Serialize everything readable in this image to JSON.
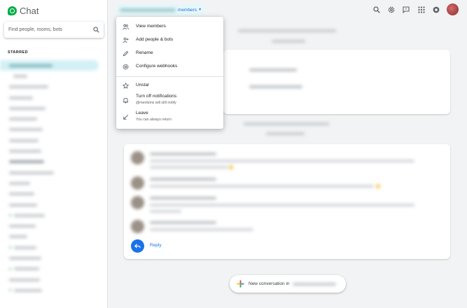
{
  "app": {
    "name": "Chat"
  },
  "search": {
    "placeholder": "Find people, rooms, bots"
  },
  "sidebar": {
    "section_label": "STARRED",
    "item_count_visible": 22
  },
  "header": {
    "members_label": "members"
  },
  "menu": {
    "items": [
      {
        "label": "View members",
        "icon": "people-icon"
      },
      {
        "label": "Add people & bots",
        "icon": "add-person-icon"
      },
      {
        "label": "Rename",
        "icon": "pencil-icon"
      },
      {
        "label": "Configure webhooks",
        "icon": "gear-icon"
      },
      {
        "label": "Unstar",
        "icon": "star-icon"
      },
      {
        "label": "Turn off notifications",
        "sublabel": "@mentions will still notify",
        "icon": "bell-icon"
      },
      {
        "label": "Leave",
        "sublabel": "You can always return",
        "icon": "leave-arrow-icon"
      }
    ]
  },
  "thread": {
    "reply_label": "Reply"
  },
  "composer": {
    "new_conversation_label": "New conversation in"
  },
  "colors": {
    "accent": "#1a73e8",
    "brand_green": "#00ac47",
    "active_room_bg": "#d3f0f4"
  }
}
